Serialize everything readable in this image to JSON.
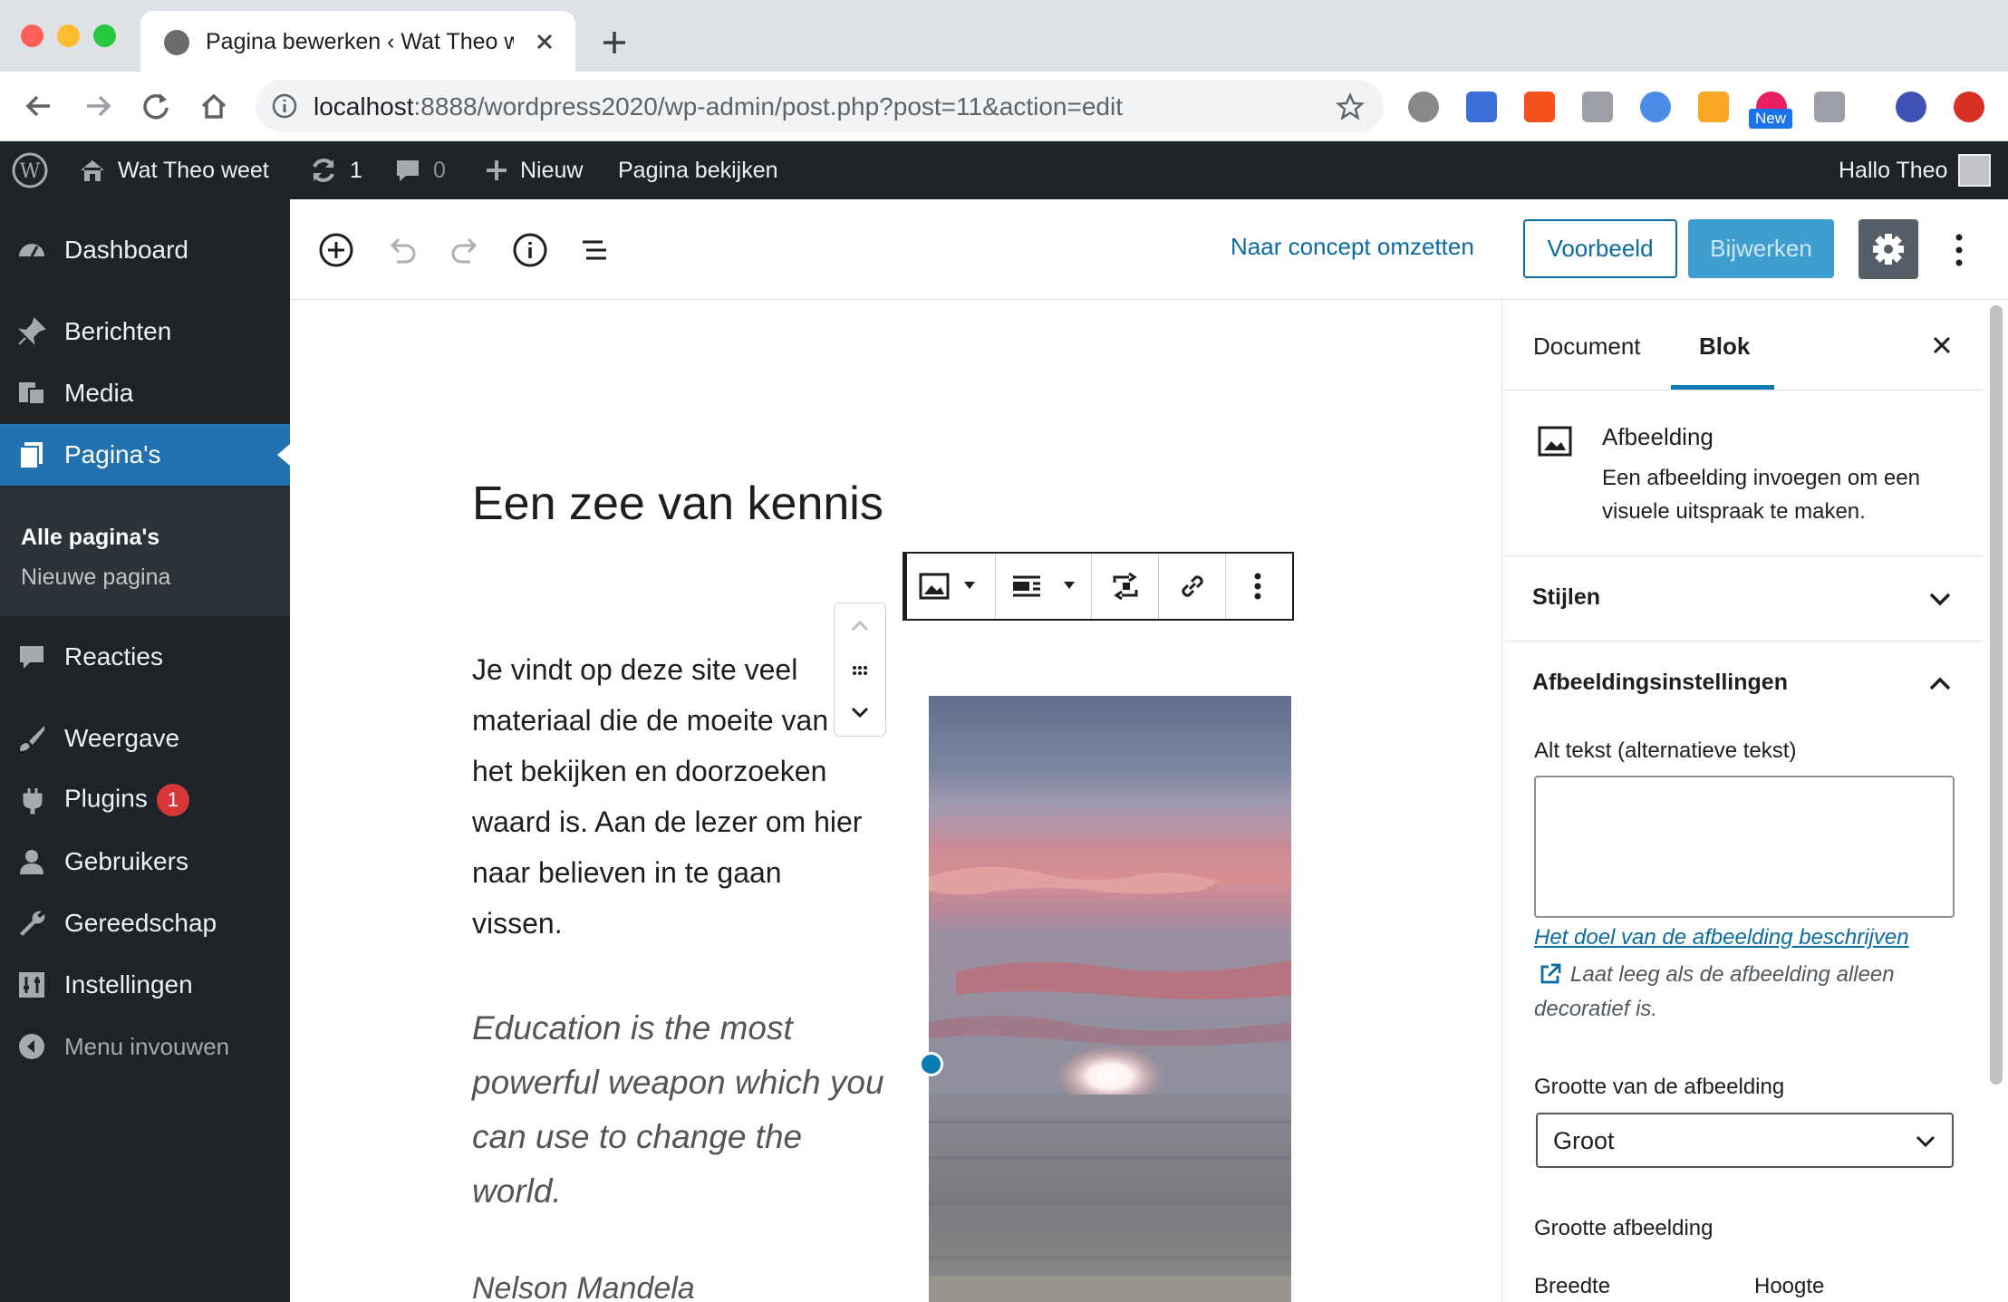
{
  "browser": {
    "tab_title": "Pagina bewerken ‹ Wat Theo weet — WordPress",
    "url_host": "localhost",
    "url_rest": ":8888/wordpress2020/wp-admin/post.php?post=11&action=edit",
    "ext_new_badge": "New",
    "icons": [
      "back-icon",
      "forward-icon",
      "reload-icon",
      "home-icon",
      "info-icon",
      "star-icon"
    ]
  },
  "adminbar": {
    "site_name": "Wat Theo weet",
    "updates_count": "1",
    "comments_count": "0",
    "new_label": "Nieuw",
    "view_page": "Pagina bekijken",
    "greeting": "Hallo Theo"
  },
  "sidebar": {
    "items": [
      {
        "label": "Dashboard",
        "icon": "dashboard-icon"
      },
      {
        "label": "Berichten",
        "icon": "pin-icon"
      },
      {
        "label": "Media",
        "icon": "media-icon"
      },
      {
        "label": "Pagina's",
        "icon": "pages-icon"
      },
      {
        "label": "Reacties",
        "icon": "comments-icon"
      },
      {
        "label": "Weergave",
        "icon": "brush-icon"
      },
      {
        "label": "Plugins",
        "icon": "plugin-icon"
      },
      {
        "label": "Gebruikers",
        "icon": "users-icon"
      },
      {
        "label": "Gereedschap",
        "icon": "wrench-icon"
      },
      {
        "label": "Instellingen",
        "icon": "settings-icon"
      },
      {
        "label": "Menu invouwen",
        "icon": "collapse-icon"
      }
    ],
    "submenu": [
      "Alle pagina's",
      "Nieuwe pagina"
    ],
    "plugins_badge": "1"
  },
  "editor": {
    "switch_to_draft": "Naar concept omzetten",
    "preview": "Voorbeeld",
    "update": "Bijwerken"
  },
  "content": {
    "title": "Een zee van kennis",
    "paragraph": "Je vindt op deze site veel materiaal die de moeite van het bekijken  en doorzoeken waard is. Aan de lezer om hier naar believen in te gaan vissen.",
    "quote": "Education is the most powerful weapon which you can use to change the world.",
    "citation": "Nelson Mandela"
  },
  "settings": {
    "tab_document": "Document",
    "tab_block": "Blok",
    "block_title": "Afbeelding",
    "block_desc": "Een afbeelding invoegen om een visuele uitspraak te maken.",
    "styles_title": "Stijlen",
    "image_settings_title": "Afbeeldingsinstellingen",
    "alt_label": "Alt tekst (alternatieve tekst)",
    "alt_value": "",
    "alt_help_link": "Het doel van de afbeelding beschrijven",
    "alt_help_text": "Laat leeg als de afbeelding alleen decoratief is.",
    "size_label": "Grootte van de afbeelding",
    "size_value": "Groot",
    "dimensions_label": "Grootte afbeelding",
    "width_label": "Breedte",
    "height_label": "Hoogte"
  },
  "colors": {
    "admin_dark": "#1d2327",
    "accent_blue": "#2271b1",
    "link_blue": "#0a6aa1",
    "update_button": "#3e9ecf"
  }
}
